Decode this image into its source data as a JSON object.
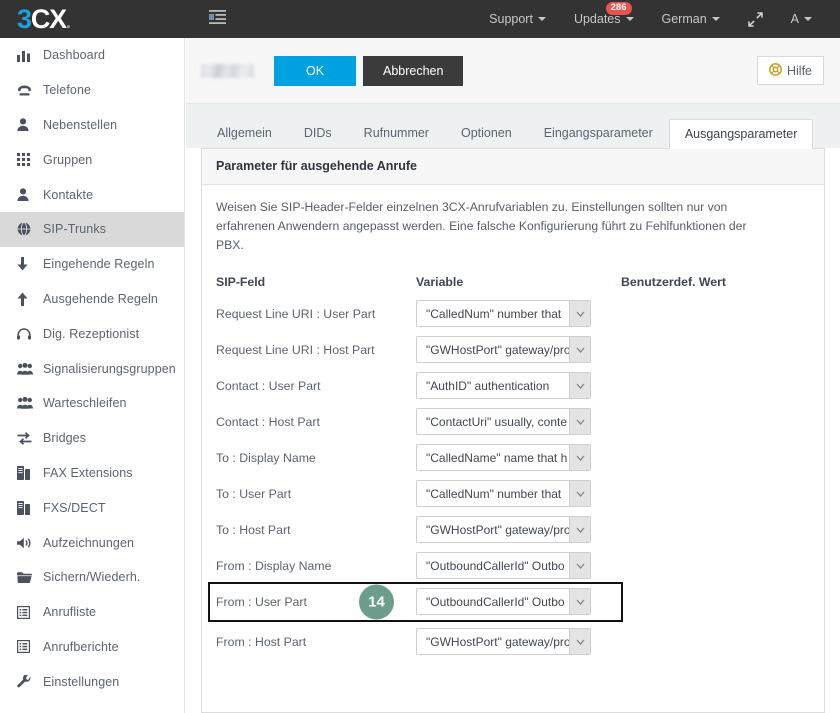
{
  "brand": {
    "part1": "3",
    "part2": "CX",
    "dot": "."
  },
  "topbar": {
    "toggle_icon": "list-toggle-icon",
    "items": [
      {
        "label": "Support",
        "icon": "chevron-down-icon",
        "badge": null
      },
      {
        "label": "Updates",
        "icon": "chevron-down-icon",
        "badge": "286"
      },
      {
        "label": "German",
        "icon": "chevron-down-icon",
        "badge": null
      }
    ],
    "expand_icon": "fullscreen-expand-icon",
    "account_label": "A"
  },
  "sidebar": {
    "items": [
      {
        "label": "Dashboard",
        "icon": "bar-chart-icon",
        "active": false
      },
      {
        "label": "Telefone",
        "icon": "telephone-icon",
        "active": false
      },
      {
        "label": "Nebenstellen",
        "icon": "user-icon",
        "active": false
      },
      {
        "label": "Gruppen",
        "icon": "grid-icon",
        "active": false
      },
      {
        "label": "Kontakte",
        "icon": "user-icon",
        "active": false
      },
      {
        "label": "SIP-Trunks",
        "icon": "globe-icon",
        "active": true
      },
      {
        "label": "Eingehende Regeln",
        "icon": "arrow-down-icon",
        "active": false
      },
      {
        "label": "Ausgehende Regeln",
        "icon": "arrow-up-icon",
        "active": false
      },
      {
        "label": "Dig. Rezeptionist",
        "icon": "headset-icon",
        "active": false
      },
      {
        "label": "Signalisierungsgruppen",
        "icon": "users-group-icon",
        "active": false
      },
      {
        "label": "Warteschleifen",
        "icon": "users-group-icon",
        "active": false
      },
      {
        "label": "Bridges",
        "icon": "exchange-arrows-icon",
        "active": false
      },
      {
        "label": "FAX Extensions",
        "icon": "fax-icon",
        "active": false
      },
      {
        "label": "FXS/DECT",
        "icon": "fax-icon",
        "active": false
      },
      {
        "label": "Aufzeichnungen",
        "icon": "speaker-icon",
        "active": false
      },
      {
        "label": "Sichern/Wiederh.",
        "icon": "folder-icon",
        "active": false
      },
      {
        "label": "Anrufliste",
        "icon": "list-report-icon",
        "active": false
      },
      {
        "label": "Anrufberichte",
        "icon": "list-report-icon",
        "active": false
      },
      {
        "label": "Einstellungen",
        "icon": "wrench-icon",
        "active": false
      }
    ]
  },
  "actionbar": {
    "title_redacted": "",
    "ok_label": "OK",
    "cancel_label": "Abbrechen",
    "help_label": "Hilfe",
    "help_icon": "lifebuoy-icon"
  },
  "tabs": [
    {
      "label": "Allgemein",
      "active": false
    },
    {
      "label": "DIDs",
      "active": false
    },
    {
      "label": "Rufnummer",
      "active": false
    },
    {
      "label": "Optionen",
      "active": false
    },
    {
      "label": "Eingangsparameter",
      "active": false
    },
    {
      "label": "Ausgangsparameter",
      "active": true
    }
  ],
  "panel": {
    "title": "Parameter für ausgehende Anrufe",
    "description": "Weisen Sie SIP-Header-Felder einzelnen 3CX-Anrufvariablen zu. Einstellungen sollten nur von erfahrenen Anwendern angepasst werden. Eine falsche Konfigurierung führt zu Fehlfunktionen der PBX.",
    "columns": {
      "sip_field": "SIP-Feld",
      "variable": "Variable",
      "custom_value": "Benutzerdef. Wert"
    },
    "rows": [
      {
        "label": "Request Line URI : User Part",
        "value": "\"CalledNum\" number that",
        "custom": "",
        "highlighted": false,
        "badge": null
      },
      {
        "label": "Request Line URI : Host Part",
        "value": "\"GWHostPort\" gateway/pro",
        "custom": "",
        "highlighted": false,
        "badge": null
      },
      {
        "label": "Contact : User Part",
        "value": "\"AuthID\" authentication",
        "custom": "",
        "highlighted": false,
        "badge": null
      },
      {
        "label": "Contact : Host Part",
        "value": "\"ContactUri\" usually, conte",
        "custom": "",
        "highlighted": false,
        "badge": null
      },
      {
        "label": "To : Display Name",
        "value": "\"CalledName\" name that h",
        "custom": "",
        "highlighted": false,
        "badge": null
      },
      {
        "label": "To : User Part",
        "value": "\"CalledNum\" number that",
        "custom": "",
        "highlighted": false,
        "badge": null
      },
      {
        "label": "To : Host Part",
        "value": "\"GWHostPort\" gateway/pro",
        "custom": "",
        "highlighted": false,
        "badge": null
      },
      {
        "label": "From : Display Name",
        "value": "\"OutboundCallerId\" Outbo",
        "custom": "",
        "highlighted": false,
        "badge": null
      },
      {
        "label": "From : User Part",
        "value": "\"OutboundCallerId\" Outbo",
        "custom": "",
        "highlighted": true,
        "badge": "14"
      },
      {
        "label": "From : Host Part",
        "value": "\"GWHostPort\" gateway/pro",
        "custom": "",
        "highlighted": false,
        "badge": null
      }
    ]
  },
  "colors": {
    "accent_blue": "#00a1e0",
    "badge_red": "#e8534f",
    "step_badge_green": "#6d9e8c",
    "topbar_dark": "#333333",
    "sidebar_active": "#d9d9d9"
  }
}
